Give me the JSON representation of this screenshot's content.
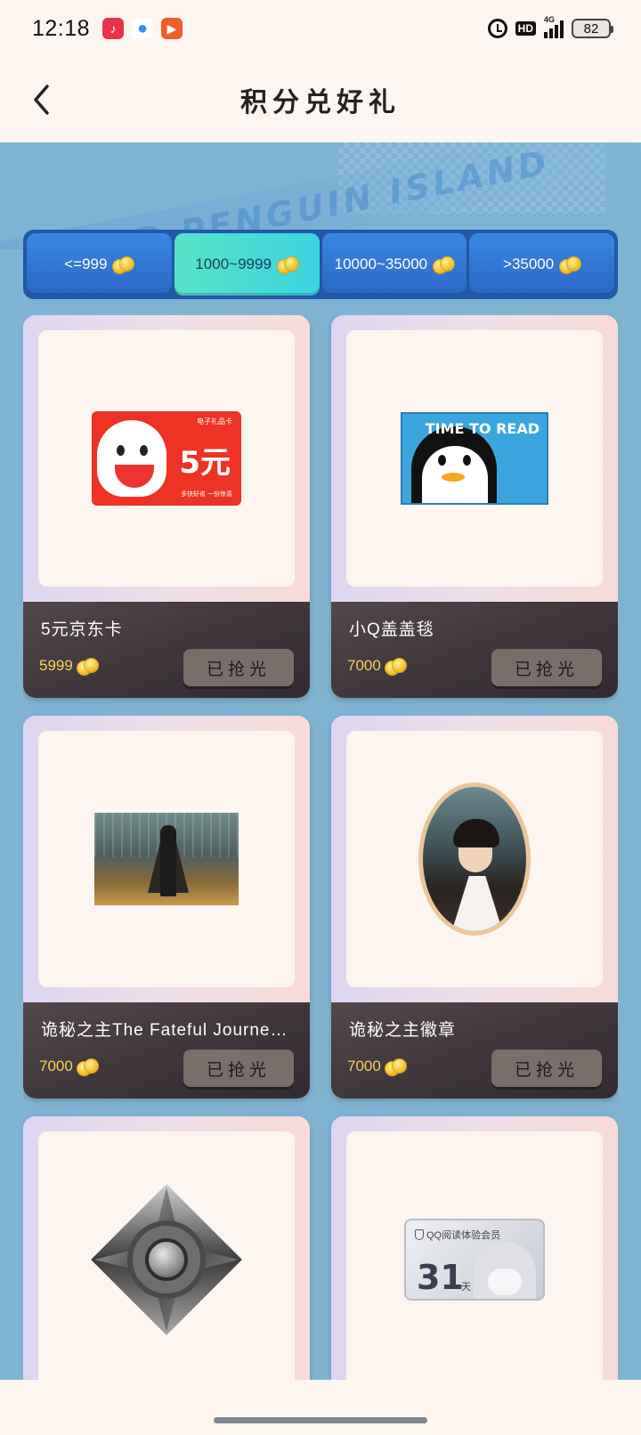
{
  "status_bar": {
    "time": "12:18",
    "hd": "HD",
    "network": "4G",
    "battery": "82"
  },
  "header": {
    "title": "积分兑好礼"
  },
  "banner": {
    "text": "ISLAND PENGUIN ISLAND"
  },
  "tabs": [
    {
      "label": "<=999",
      "active": false
    },
    {
      "label": "1000~9999",
      "active": true
    },
    {
      "label": "10000~35000",
      "active": false
    },
    {
      "label": ">35000",
      "active": false
    }
  ],
  "products": [
    {
      "name": "5元京东卡",
      "price": "5999",
      "status": "已抢光",
      "image_text": "5元",
      "image_small": "电子礼品卡",
      "image_small2": "多快好省 一份惊喜"
    },
    {
      "name": "小Q盖盖毯",
      "price": "7000",
      "status": "已抢光",
      "image_text": "TIME TO READ"
    },
    {
      "name": "诡秘之主The Fateful Journey ...",
      "price": "7000",
      "status": "已抢光"
    },
    {
      "name": "诡秘之主徽章",
      "price": "7000",
      "status": "已抢光"
    },
    {
      "name": "",
      "price": "",
      "status": ""
    },
    {
      "name": "",
      "price": "",
      "status": "",
      "image_label": "QQ阅读体验会员",
      "image_num": "31",
      "image_unit": "天"
    }
  ]
}
